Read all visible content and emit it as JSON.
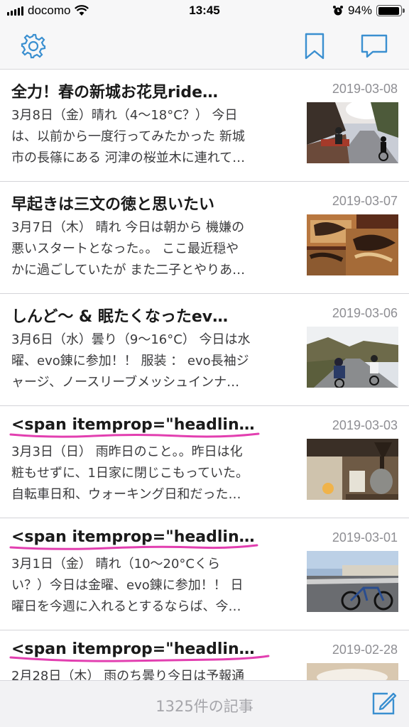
{
  "status": {
    "carrier": "docomo",
    "time": "13:45",
    "battery": "94%",
    "battery_level": 0.94
  },
  "nav": {
    "icons": [
      "gear-icon",
      "bookmark-icon",
      "comment-icon"
    ],
    "accent": "#3a8fd0"
  },
  "articles": [
    {
      "title": "全力！春の新城お花見ride…",
      "date": "2019-03-08",
      "lines": [
        "3月8日（金）晴れ（4〜18°C？） 今日",
        "は、以前から一度行ってみたかった 新城",
        "市の長篠にある 河津の桜並木に連れて…"
      ]
    },
    {
      "title": "早起きは三文の徳と思いたい",
      "date": "2019-03-07",
      "lines": [
        "3月7日（木） 晴れ 今日は朝から 機嫌の",
        "悪いスタートとなった。。 ここ最近穏や",
        "かに過ごしていたが また二子とやりあ…"
      ]
    },
    {
      "title": "しんど〜 & 眠たくなったev…",
      "date": "2019-03-06",
      "lines": [
        "3月6日（水）曇り（9〜16°C） 今日は水",
        "曜、evo錬に参加！！ 服装 ： evo長袖ジ",
        "ャージ、ノースリーブメッシュインナ…"
      ]
    },
    {
      "title": "<span itemprop=\"headlin…",
      "date": "2019-03-03",
      "lines": [
        "3月3日（日） 雨昨日のこと。。昨日は化",
        "粧もせずに、1日家に閉じこもっていた。",
        "自転車日和、ウォーキング日和だった…"
      ]
    },
    {
      "title": "<span itemprop=\"headlin…",
      "date": "2019-03-01",
      "lines": [
        "3月1日（金） 晴れ（10〜20°Cくら",
        "い？）今日は金曜、evo錬に参加！！ 日",
        "曜日を今週に入れるとするならば、今…"
      ]
    },
    {
      "title": "<span itemprop=\"headlin…",
      "date": "2019-02-28",
      "lines": [
        "2月28日（木） 雨のち曇り今日は予報通"
      ]
    }
  ],
  "toolbar": {
    "count_label": "1325件の記事"
  }
}
